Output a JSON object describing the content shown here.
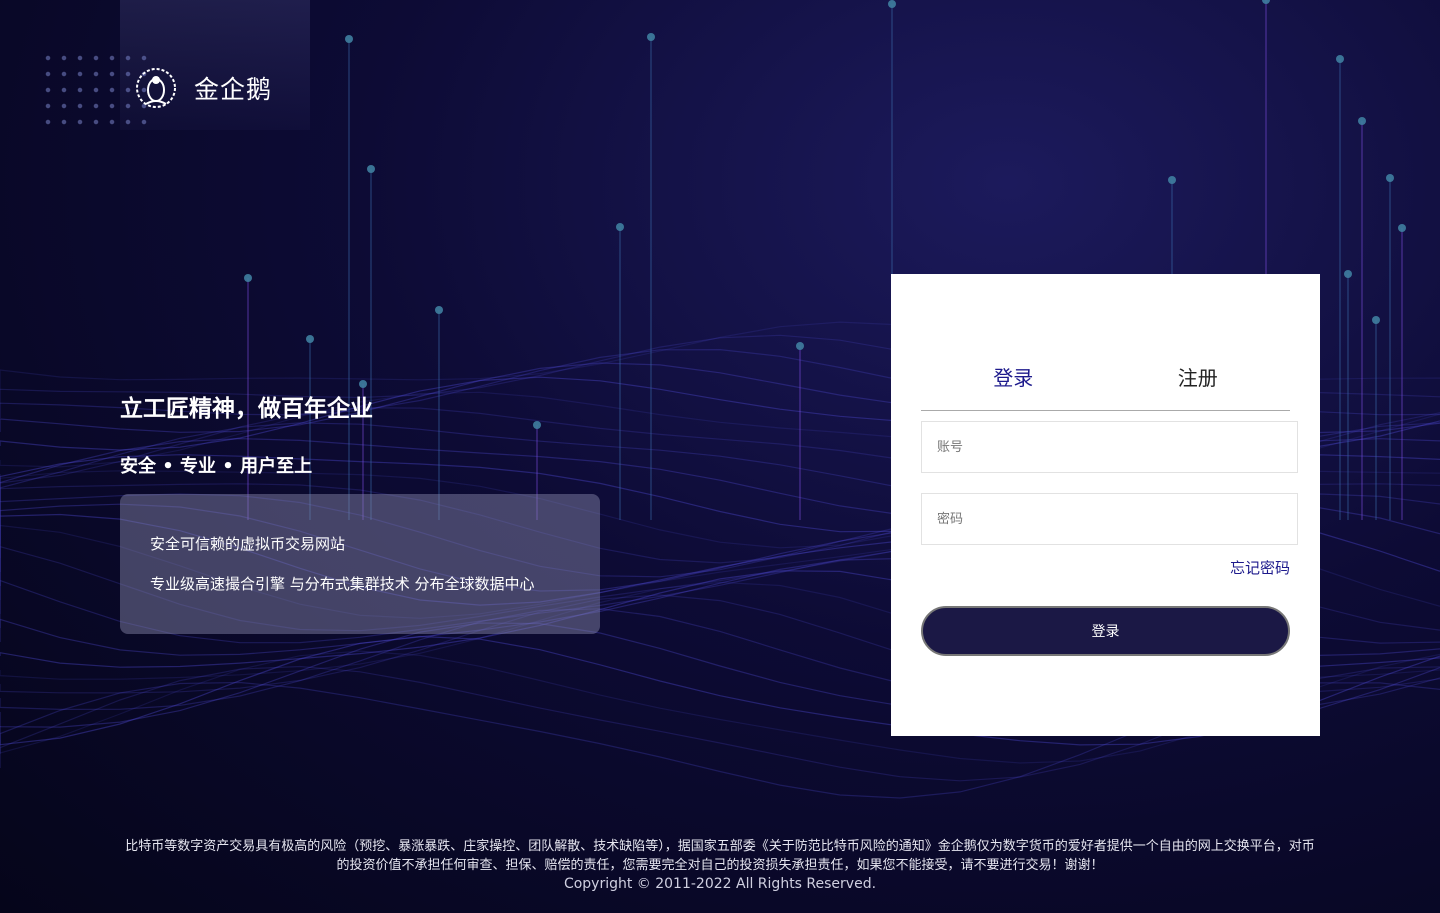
{
  "brand": {
    "name": "金企鹅"
  },
  "hero": {
    "slogan": "立工匠精神，做百年企业",
    "subslogan": "安全 • 专业 • 用户至上",
    "features": [
      "安全可信赖的虚拟币交易网站",
      "专业级高速撮合引擎 与分布式集群技术 分布全球数据中心"
    ]
  },
  "login_card": {
    "tabs": [
      {
        "label": "登录",
        "active": true
      },
      {
        "label": "注册",
        "active": false
      }
    ],
    "account_placeholder": "账号",
    "password_placeholder": "密码",
    "forgot_label": "忘记密码",
    "submit_label": "登录"
  },
  "footer": {
    "disclaimer": "比特币等数字资产交易具有极高的风险（预挖、暴涨暴跌、庄家操控、团队解散、技术缺陷等），据国家五部委《关于防范比特币风险的通知》金企鹅仅为数字货币的爱好者提供一个自由的网上交换平台，对币的投资价值不承担任何审查、担保、赔偿的责任，您需要完全对自己的投资损失承担责任，如果您不能接受，请不要进行交易！谢谢！",
    "copyright": "Copyright © 2011-2022 All Rights Reserved."
  },
  "colors": {
    "accent": "#1d1a8c",
    "button": "#1b1845",
    "background": "#0d0b35"
  }
}
